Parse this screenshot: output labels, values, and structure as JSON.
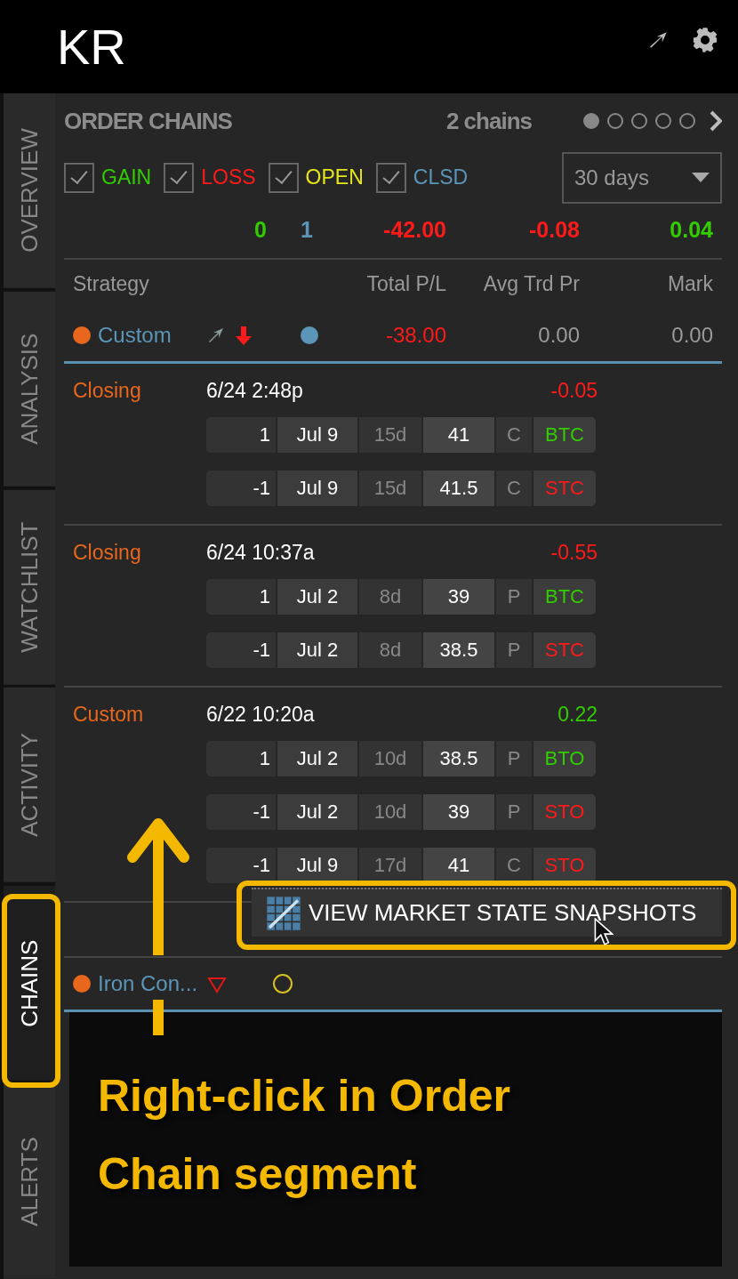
{
  "header": {
    "title": "KR"
  },
  "sidebar": {
    "tabs": [
      {
        "label": "OVERVIEW",
        "selected": false
      },
      {
        "label": "ANALYSIS",
        "selected": false
      },
      {
        "label": "WATCHLIST",
        "selected": false
      },
      {
        "label": "ACTIVITY",
        "selected": false
      },
      {
        "label": "CHAINS",
        "selected": true
      },
      {
        "label": "ALERTS",
        "selected": false
      }
    ]
  },
  "panel": {
    "title": "ORDER CHAINS",
    "count": "2 chains",
    "pages": [
      {
        "selected": true
      },
      {
        "selected": false
      },
      {
        "selected": false
      },
      {
        "selected": false
      },
      {
        "selected": false
      }
    ],
    "filters": [
      {
        "label": "GAIN",
        "checked": true,
        "color": "#33cc00"
      },
      {
        "label": "LOSS",
        "checked": true,
        "color": "#ff1a1a"
      },
      {
        "label": "OPEN",
        "checked": true,
        "color": "#e6e619"
      },
      {
        "label": "CLSD",
        "checked": true,
        "color": "#5b95b8"
      }
    ],
    "period": "30 days",
    "totals": [
      {
        "value": "0",
        "color": "#33cc00"
      },
      {
        "value": "1",
        "color": "#5b95b8"
      },
      {
        "value": "-42.00",
        "color": "#ff1a1a"
      },
      {
        "value": "-0.08",
        "color": "#ff1a1a"
      },
      {
        "value": "0.04",
        "color": "#33cc00"
      }
    ],
    "columns": [
      "Strategy",
      "Total P/L",
      "Avg Trd Pr",
      "Mark"
    ],
    "chains": [
      {
        "name": "Custom",
        "markers": [
          {
            "kind": "trend-arrow"
          },
          {
            "kind": "down-arrow"
          },
          {
            "kind": "dot",
            "color": "#5b95b8"
          }
        ],
        "total_pl": "-38.00",
        "avg_trd_pr": "0.00",
        "mark": "0.00",
        "segments": [
          {
            "label": "Closing",
            "time": "6/24 2:48p",
            "pl": "-0.05",
            "color": "#ff1a1a",
            "legs": [
              {
                "qty": "1",
                "exp": "Jul 9",
                "dte": "15d",
                "strike": "41",
                "type": "C",
                "action": "BTC",
                "color": "#33cc00"
              },
              {
                "qty": "-1",
                "exp": "Jul 9",
                "dte": "15d",
                "strike": "41.5",
                "type": "C",
                "action": "STC",
                "color": "#ff1a1a"
              }
            ]
          },
          {
            "label": "Closing",
            "time": "6/24 10:37a",
            "pl": "-0.55",
            "color": "#ff1a1a",
            "legs": [
              {
                "qty": "1",
                "exp": "Jul 2",
                "dte": "8d",
                "strike": "39",
                "type": "P",
                "action": "BTC",
                "color": "#33cc00"
              },
              {
                "qty": "-1",
                "exp": "Jul 2",
                "dte": "8d",
                "strike": "38.5",
                "type": "P",
                "action": "STC",
                "color": "#ff1a1a"
              }
            ]
          },
          {
            "label": "Custom",
            "time": "6/22 10:20a",
            "pl": "0.22",
            "color": "#33cc00",
            "legs": [
              {
                "qty": "1",
                "exp": "Jul 2",
                "dte": "10d",
                "strike": "38.5",
                "type": "P",
                "action": "BTO",
                "color": "#33cc00"
              },
              {
                "qty": "-1",
                "exp": "Jul 2",
                "dte": "10d",
                "strike": "39",
                "type": "P",
                "action": "STO",
                "color": "#ff1a1a"
              },
              {
                "qty": "-1",
                "exp": "Jul 9",
                "dte": "17d",
                "strike": "41",
                "type": "C",
                "action": "STO",
                "color": "#ff1a1a"
              }
            ]
          }
        ]
      },
      {
        "name": "Iron Con...",
        "markers": [
          {
            "kind": "down-triangle"
          },
          {
            "kind": "ring",
            "color": "#d8c020"
          }
        ]
      }
    ]
  },
  "context_menu": {
    "items": [
      {
        "label": "VIEW MARKET STATE SNAPSHOTS"
      }
    ]
  },
  "annotation": {
    "caption": "Right-click in Order Chain segment"
  }
}
